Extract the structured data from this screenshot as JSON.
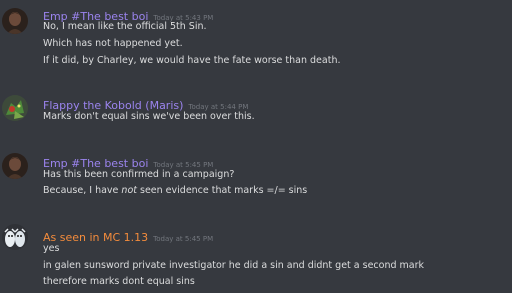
{
  "messages": [
    {
      "author": "Emp #The best boi",
      "author_color": "#9b84ee",
      "timestamp": "Today at 5:43 PM",
      "avatar_icon": "dark-portrait-avatar",
      "lines": [
        "No, I mean like the official 5th Sin.",
        "Which has not happened yet.",
        "If it did, by Charley, we would have the fate worse than death."
      ]
    },
    {
      "author": "Flappy the Kobold (Maris)",
      "author_color": "#9b84ee",
      "timestamp": "Today at 5:44 PM",
      "avatar_icon": "kobold-avatar",
      "lines": [
        "Marks don't equal sins we've been over this."
      ]
    },
    {
      "author": "Emp #The best boi",
      "author_color": "#9b84ee",
      "timestamp": "Today at 5:45 PM",
      "avatar_icon": "dark-portrait-avatar",
      "lines": [
        "Has this been confirmed in a campaign?",
        {
          "before": "Because, I have ",
          "em": "not",
          "after": " seen evidence that marks =/= sins"
        }
      ]
    },
    {
      "author": "As seen in MC 1.13",
      "author_color": "#f48c3c",
      "timestamp": "Today at 5:45 PM",
      "avatar_icon": "cartoon-characters-avatar",
      "lines": [
        "yes",
        "in galen sunsword private investigator he did a sin and didnt get a second mark",
        "therefore marks dont equal sins"
      ]
    }
  ]
}
